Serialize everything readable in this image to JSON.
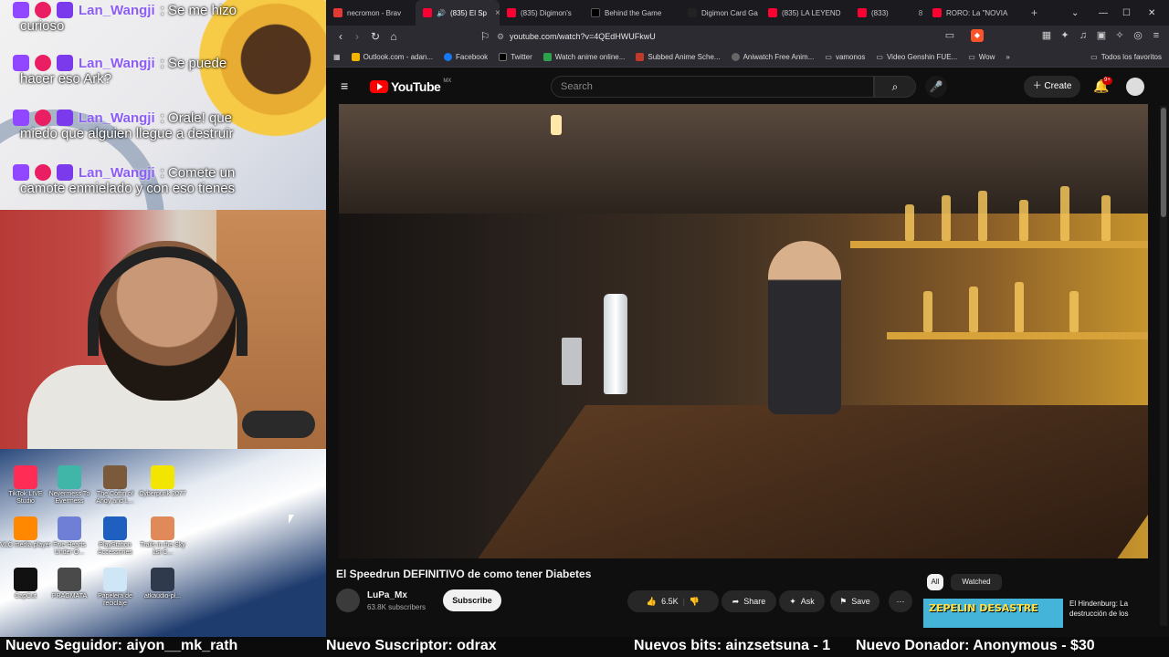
{
  "chat": {
    "messages": [
      {
        "user": "Lan_Wangji",
        "line1": ": Se me hizo",
        "line2": "curioso"
      },
      {
        "user": "Lan_Wangji",
        "line1": ": Se puede",
        "line2": "hacer eso Ark?"
      },
      {
        "user": "Lan_Wangji",
        "line1": ": Orale! que",
        "line2": "miedo que alguien llegue a destruir"
      },
      {
        "user": "Lan_Wangji",
        "line1": ": Comete un",
        "line2": "camote enmielado y con eso tienes"
      }
    ]
  },
  "desktop": {
    "icons": [
      {
        "label": "TikTok LIVE Studio",
        "color": "#ff2d55"
      },
      {
        "label": "Nevermess To Evermess",
        "color": "#3fb6a8"
      },
      {
        "label": "The Coffin of Andy and L...",
        "color": "#7a5a3a"
      },
      {
        "label": "Cyberpunk 2077",
        "color": "#f2e600"
      },
      {
        "label": "VLC media player",
        "color": "#ff8800"
      },
      {
        "label": "Five Hearts Under O...",
        "color": "#6f7fd6"
      },
      {
        "label": "PlayStation Accessories",
        "color": "#1f5fbf"
      },
      {
        "label": "Trails in the Sky 1st C...",
        "color": "#e08a5a"
      },
      {
        "label": "CapCut",
        "color": "#111111"
      },
      {
        "label": "PRAGMATA",
        "color": "#4a4a4a"
      },
      {
        "label": "Papelera de reciclaje",
        "color": "#cfe6f7"
      },
      {
        "label": "atkaudio-pl...",
        "color": "#2f3a4c"
      }
    ]
  },
  "browser": {
    "tabs": [
      {
        "label": "necromon - Brav",
        "color": "#e53935",
        "active": false
      },
      {
        "label": "(835) El Sp",
        "color": "#ff0033",
        "active": true
      },
      {
        "label": "(835) Digimon's",
        "color": "#ff0033",
        "active": false
      },
      {
        "label": "Behind the Game",
        "color": "#000000",
        "active": false
      },
      {
        "label": "Digimon Card Ga",
        "color": "#222222",
        "active": false
      },
      {
        "label": "(835) LA LEYEND",
        "color": "#ff0033",
        "active": false
      },
      {
        "label": "(833)",
        "color": "#ff0033",
        "active": false
      },
      {
        "label": "RORO: La \"NOVIA",
        "color": "#ff0033",
        "active": false
      }
    ],
    "url": "youtube.com/watch?v=4QEdHWUFkwU",
    "bookmarks": [
      {
        "label": "Outlook.com - adan...",
        "color": "#0f6cbd"
      },
      {
        "label": "Facebook",
        "color": "#1877f2"
      },
      {
        "label": "Twitter",
        "color": "#000000"
      },
      {
        "label": "Watch anime online...",
        "color": "#2ca24d"
      },
      {
        "label": "Subbed Anime Sche...",
        "color": "#c0392b"
      },
      {
        "label": "Aniwatch Free Anim...",
        "color": "#666666"
      },
      {
        "label": "vamonos",
        "color": "#888888"
      },
      {
        "label": "Video Genshin FUE...",
        "color": "#888888"
      },
      {
        "label": "Wow",
        "color": "#888888"
      }
    ],
    "bookmarks_end": "Todos los favoritos"
  },
  "youtube": {
    "logo": "YouTube",
    "country": "MX",
    "search_placeholder": "Search",
    "create": "Create",
    "notif_count": "9+",
    "video_title": "El Speedrun DEFINITIVO de como tener Diabetes",
    "channel": "LuPa_Mx",
    "subscribers": "63.8K subscribers",
    "subscribe": "Subscribe",
    "likes": "6.5K",
    "share": "Share",
    "ask": "Ask",
    "save": "Save",
    "chips": [
      "All",
      "Watched"
    ],
    "rec_thumb_text": "ZEPELIN DESASTRE",
    "rec_title": "El Hindenburg: La destrucción de los"
  },
  "ticker": {
    "follower": "Nuevo Seguidor: aiyon__mk_rath",
    "subscriber": "Nuevo Suscriptor: odrax",
    "bits": "Nuevos bits: ainzsetsuna - 1",
    "donor": "Nuevo Donador: Anonymous - $30"
  }
}
